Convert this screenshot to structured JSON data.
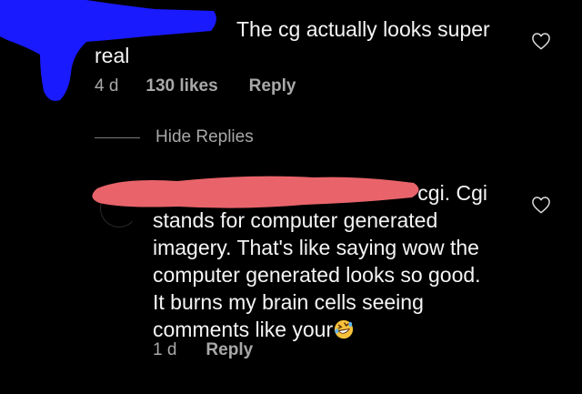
{
  "comment1": {
    "text": "The cg actually looks super real",
    "time": "4 d",
    "likes": "130 likes",
    "reply_label": "Reply"
  },
  "thread": {
    "hide_replies_label": "Hide Replies"
  },
  "comment2": {
    "first_line": "cgi. Cgi",
    "body": "stands for computer generated imagery. That's like saying wow the computer generated looks so good. It burns my brain cells seeing comments like your",
    "emoji": "rolling-on-floor-laughing-emoji",
    "time": "1 d",
    "reply_label": "Reply"
  },
  "colors": {
    "background": "#000000",
    "text": "#f5f5f5",
    "secondary_text": "#a8a8a8",
    "redaction_blue": "#1a1aff",
    "redaction_red": "#e8646a"
  },
  "icons": [
    "heart-outline-icon",
    "heart-outline-icon"
  ]
}
